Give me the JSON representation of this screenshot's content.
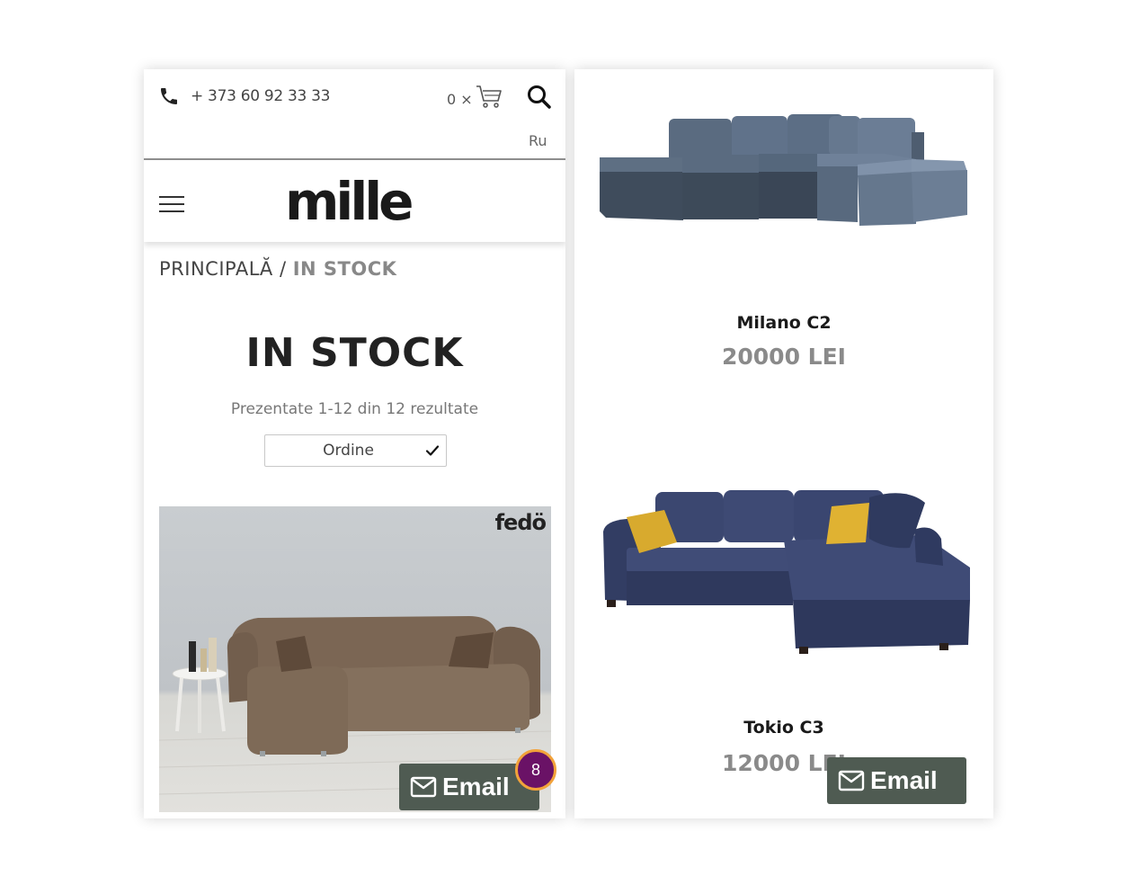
{
  "header": {
    "phone": "+ 373 60 92 33 33",
    "cart_count": "0 ×",
    "language": "Ru",
    "logo": "mille"
  },
  "breadcrumb": {
    "home": "PRINCIPALĂ",
    "separator": " / ",
    "current": "IN STOCK"
  },
  "page": {
    "title": "IN STOCK",
    "results": "Prezentate 1-12 din 12 rezultate",
    "sort_label": "Ordine"
  },
  "products": [
    {
      "brand": "fedö"
    },
    {
      "name": "Milano C2",
      "price": "20000 LEI"
    },
    {
      "name": "Tokio C3",
      "price": "12000 LEI"
    }
  ],
  "widgets": {
    "email_label": "Email",
    "badge_count": "8"
  },
  "colors": {
    "email_button": "#4f5b52",
    "badge": "#6a1266",
    "badge_border": "#f2a23a",
    "price": "#8a8a8a"
  }
}
